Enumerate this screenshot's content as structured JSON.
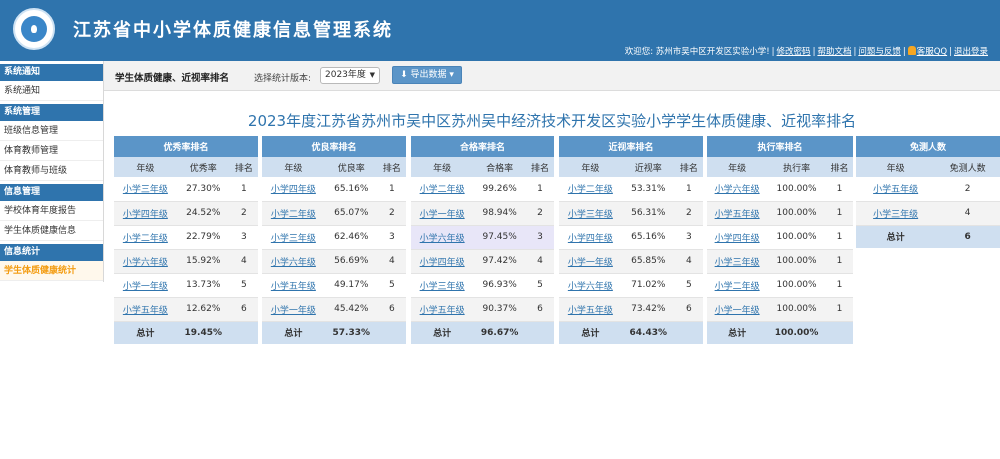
{
  "header": {
    "title": "江苏省中小学体质健康信息管理系统",
    "welcome": "欢迎您: 苏州市吴中区开发区实验小学!",
    "links": [
      "修改密码",
      "帮助文档",
      "问题与反馈",
      "客服QQ",
      "退出登录"
    ]
  },
  "sidebar": {
    "sections": [
      {
        "title": "系统通知",
        "items": [
          "系统通知"
        ]
      },
      {
        "title": "系统管理",
        "items": [
          "班级信息管理",
          "体育教师管理",
          "体育教师与班级"
        ]
      },
      {
        "title": "信息管理",
        "items": [
          "学校体育年度报告",
          "学生体质健康信息"
        ]
      },
      {
        "title": "信息统计",
        "items": [
          "学生体质健康统计"
        ]
      }
    ],
    "active": "学生体质健康统计"
  },
  "toolbar": {
    "crumb": "学生体质健康、近视率排名",
    "version_label": "选择统计版本:",
    "version_value": "2023年度",
    "export_label": "导出数据"
  },
  "page_heading": "2023年度江苏省苏州市吴中区苏州吴中经济技术开发区实验小学学生体质健康、近视率排名",
  "tables": [
    {
      "caption": "优秀率排名",
      "columns": [
        "年级",
        "优秀率",
        "排名"
      ],
      "rows": [
        [
          "小学三年级",
          "27.30%",
          "1"
        ],
        [
          "小学四年级",
          "24.52%",
          "2"
        ],
        [
          "小学二年级",
          "22.79%",
          "3"
        ],
        [
          "小学六年级",
          "15.92%",
          "4"
        ],
        [
          "小学一年级",
          "13.73%",
          "5"
        ],
        [
          "小学五年级",
          "12.62%",
          "6"
        ]
      ],
      "total": [
        "总计",
        "19.45%",
        ""
      ]
    },
    {
      "caption": "优良率排名",
      "columns": [
        "年级",
        "优良率",
        "排名"
      ],
      "rows": [
        [
          "小学四年级",
          "65.16%",
          "1"
        ],
        [
          "小学二年级",
          "65.07%",
          "2"
        ],
        [
          "小学三年级",
          "62.46%",
          "3"
        ],
        [
          "小学六年级",
          "56.69%",
          "4"
        ],
        [
          "小学五年级",
          "49.17%",
          "5"
        ],
        [
          "小学一年级",
          "45.42%",
          "6"
        ]
      ],
      "total": [
        "总计",
        "57.33%",
        ""
      ]
    },
    {
      "caption": "合格率排名",
      "columns": [
        "年级",
        "合格率",
        "排名"
      ],
      "rows": [
        [
          "小学二年级",
          "99.26%",
          "1"
        ],
        [
          "小学一年级",
          "98.94%",
          "2"
        ],
        [
          "小学六年级",
          "97.45%",
          "3"
        ],
        [
          "小学四年级",
          "97.42%",
          "4"
        ],
        [
          "小学三年级",
          "96.93%",
          "5"
        ],
        [
          "小学五年级",
          "90.37%",
          "6"
        ]
      ],
      "total": [
        "总计",
        "96.67%",
        ""
      ]
    },
    {
      "caption": "近视率排名",
      "columns": [
        "年级",
        "近视率",
        "排名"
      ],
      "rows": [
        [
          "小学二年级",
          "53.31%",
          "1"
        ],
        [
          "小学三年级",
          "56.31%",
          "2"
        ],
        [
          "小学四年级",
          "65.16%",
          "3"
        ],
        [
          "小学一年级",
          "65.85%",
          "4"
        ],
        [
          "小学六年级",
          "71.02%",
          "5"
        ],
        [
          "小学五年级",
          "73.42%",
          "6"
        ]
      ],
      "total": [
        "总计",
        "64.43%",
        ""
      ]
    },
    {
      "caption": "执行率排名",
      "columns": [
        "年级",
        "执行率",
        "排名"
      ],
      "rows": [
        [
          "小学六年级",
          "100.00%",
          "1"
        ],
        [
          "小学五年级",
          "100.00%",
          "1"
        ],
        [
          "小学四年级",
          "100.00%",
          "1"
        ],
        [
          "小学三年级",
          "100.00%",
          "1"
        ],
        [
          "小学二年级",
          "100.00%",
          "1"
        ],
        [
          "小学一年级",
          "100.00%",
          "1"
        ]
      ],
      "total": [
        "总计",
        "100.00%",
        ""
      ]
    },
    {
      "caption": "免测人数",
      "columns": [
        "年级",
        "免测人数"
      ],
      "rows": [
        [
          "小学五年级",
          "2"
        ],
        [
          "小学三年级",
          "4"
        ]
      ],
      "total": [
        "总计",
        "6"
      ]
    }
  ],
  "colors": {
    "header_bg": "#2f74ad",
    "caption_bg": "#5b95c8",
    "column_header_bg": "#cfdff0",
    "active_menu": "#f39c12",
    "highlight_row": "#e8e6f8"
  }
}
